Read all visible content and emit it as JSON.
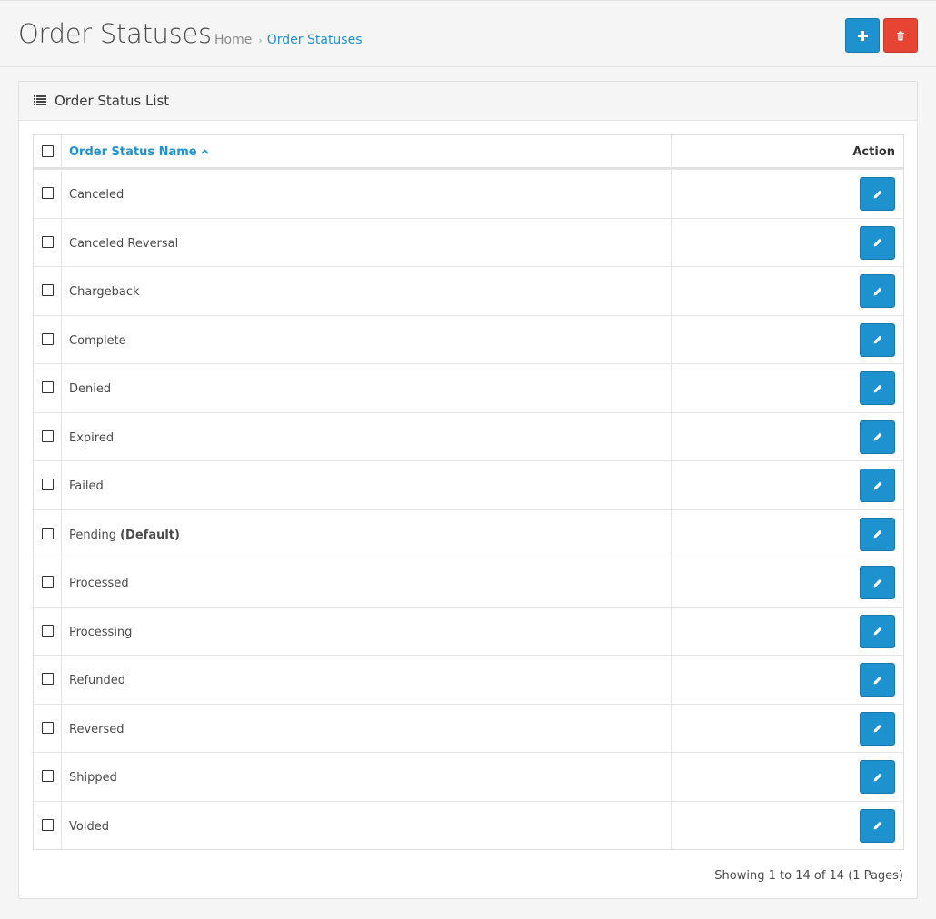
{
  "header": {
    "title": "Order Statuses",
    "breadcrumb": [
      {
        "label": "Home"
      },
      {
        "label": "Order Statuses"
      }
    ],
    "add_button_icon": "plus-icon",
    "delete_button_icon": "trash-icon"
  },
  "panel": {
    "title": "Order Status List",
    "icon": "list-icon"
  },
  "table": {
    "columns": {
      "name": "Order Status Name",
      "action": "Action"
    },
    "sort_indicator": "chevron-up-icon",
    "rows": [
      {
        "name": "Canceled",
        "suffix": ""
      },
      {
        "name": "Canceled Reversal",
        "suffix": ""
      },
      {
        "name": "Chargeback",
        "suffix": ""
      },
      {
        "name": "Complete",
        "suffix": ""
      },
      {
        "name": "Denied",
        "suffix": ""
      },
      {
        "name": "Expired",
        "suffix": ""
      },
      {
        "name": "Failed",
        "suffix": ""
      },
      {
        "name": "Pending",
        "suffix": "(Default)"
      },
      {
        "name": "Processed",
        "suffix": ""
      },
      {
        "name": "Processing",
        "suffix": ""
      },
      {
        "name": "Refunded",
        "suffix": ""
      },
      {
        "name": "Reversed",
        "suffix": ""
      },
      {
        "name": "Shipped",
        "suffix": ""
      },
      {
        "name": "Voided",
        "suffix": ""
      }
    ]
  },
  "pagination": {
    "summary": "Showing 1 to 14 of 14 (1 Pages)"
  },
  "colors": {
    "primary": "#1e91cf",
    "danger": "#e64534"
  }
}
